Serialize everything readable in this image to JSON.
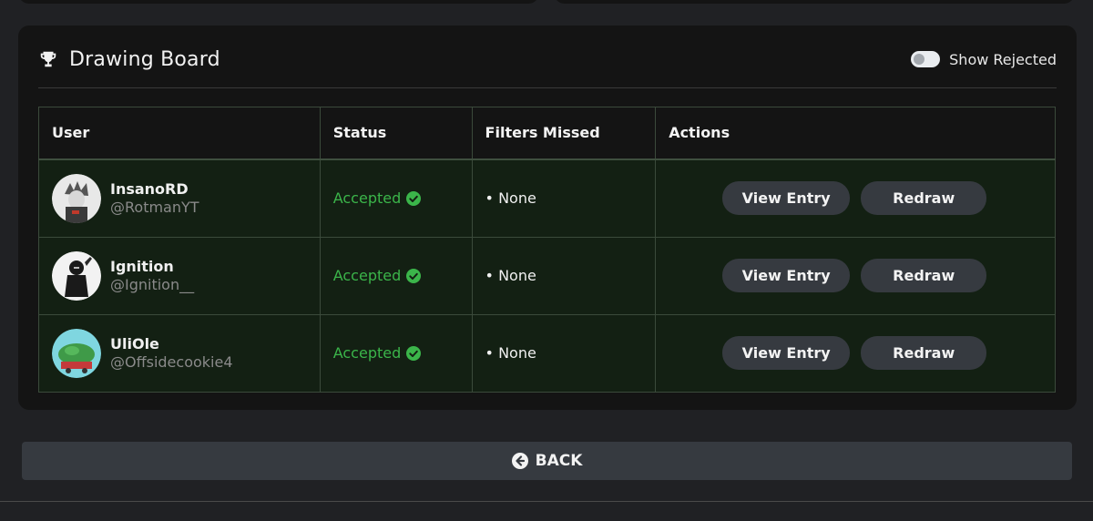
{
  "panel": {
    "title": "Drawing Board",
    "show_rejected_label": "Show Rejected",
    "show_rejected_on": false
  },
  "table": {
    "headers": [
      "User",
      "Status",
      "Filters Missed",
      "Actions"
    ],
    "rows": [
      {
        "name": "InsanoRD",
        "handle": "@RotmanYT",
        "status": "Accepted",
        "filters_missed": "• None",
        "view_label": "View Entry",
        "redraw_label": "Redraw"
      },
      {
        "name": "Ignition",
        "handle": "@Ignition__",
        "status": "Accepted",
        "filters_missed": "• None",
        "view_label": "View Entry",
        "redraw_label": "Redraw"
      },
      {
        "name": "UliOle",
        "handle": "@Offsidecookie4",
        "status": "Accepted",
        "filters_missed": "• None",
        "view_label": "View Entry",
        "redraw_label": "Redraw"
      }
    ]
  },
  "back": {
    "label": "BACK"
  },
  "colors": {
    "accepted": "#3bb54a",
    "button_bg": "#363a40",
    "row_bg": "#132013",
    "panel_bg": "#141414",
    "page_bg": "#202124"
  },
  "icons": {
    "title": "trophy-icon",
    "status": "check-circle-icon",
    "back": "arrow-left-circle-icon"
  }
}
